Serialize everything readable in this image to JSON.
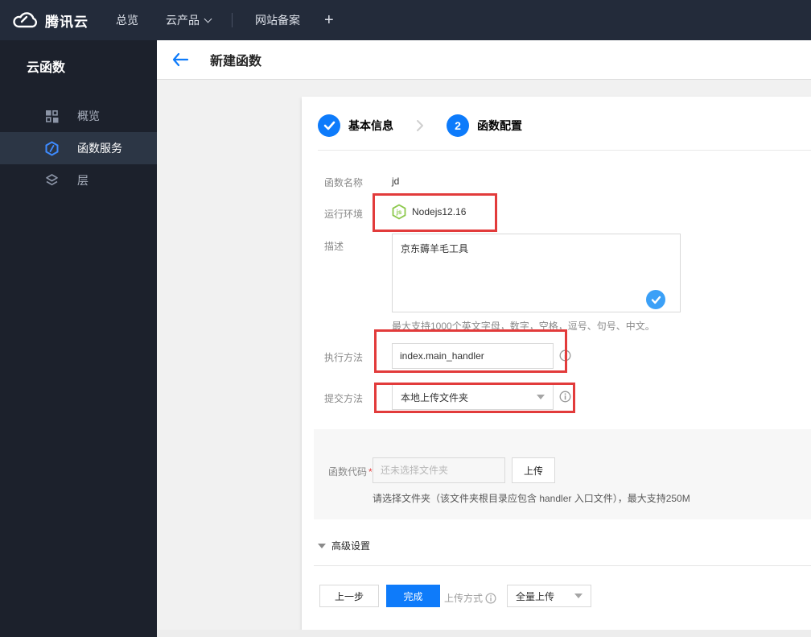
{
  "topbar": {
    "brand": "腾讯云",
    "items": [
      {
        "label": "总览"
      },
      {
        "label": "云产品",
        "has_caret": true
      },
      {
        "label": "网站备案"
      }
    ],
    "plus": "+"
  },
  "sidebar": {
    "title": "云函数",
    "items": [
      {
        "label": "概览",
        "icon": "grid-icon",
        "active": false
      },
      {
        "label": "函数服务",
        "icon": "function-hexagon-icon",
        "active": true
      },
      {
        "label": "层",
        "icon": "layers-icon",
        "active": false
      }
    ]
  },
  "header": {
    "title": "新建函数",
    "back_icon": "arrow-left-icon"
  },
  "steps": [
    {
      "label": "基本信息",
      "state": "done",
      "icon": "check-icon"
    },
    {
      "label": "函数配置",
      "number": "2",
      "state": "current"
    }
  ],
  "form": {
    "name": {
      "label": "函数名称",
      "value": "jd"
    },
    "runtime": {
      "label": "运行环境",
      "value": "Nodejs12.16",
      "icon": "nodejs-icon"
    },
    "description": {
      "label": "描述",
      "value": "京东薅羊毛工具",
      "hint": "最大支持1000个英文字母，数字，空格，逗号、句号、中文。"
    },
    "handler": {
      "label": "执行方法",
      "value": "index.main_handler"
    },
    "submit_method": {
      "label": "提交方法",
      "value": "本地上传文件夹"
    },
    "code": {
      "label": "函数代码",
      "required": "*",
      "placeholder": "还未选择文件夹",
      "upload_label": "上传",
      "hint": "请选择文件夹（该文件夹根目录应包含 handler 入口文件），最大支持250M"
    },
    "advanced_label": "高级设置"
  },
  "footer": {
    "prev_label": "上一步",
    "finish_label": "完成",
    "upload_mode_label": "上传方式",
    "upload_mode_value": "全量上传"
  },
  "colors": {
    "accent_blue": "#0e7bfa",
    "light_check_blue": "#3ba0f7",
    "annotation_red": "#e23b3b",
    "node_green": "#8cc84b",
    "topbar_bg": "#232b3a",
    "sidebar_bg": "#1c212c",
    "sidebar_active_bg": "#2c3645"
  }
}
